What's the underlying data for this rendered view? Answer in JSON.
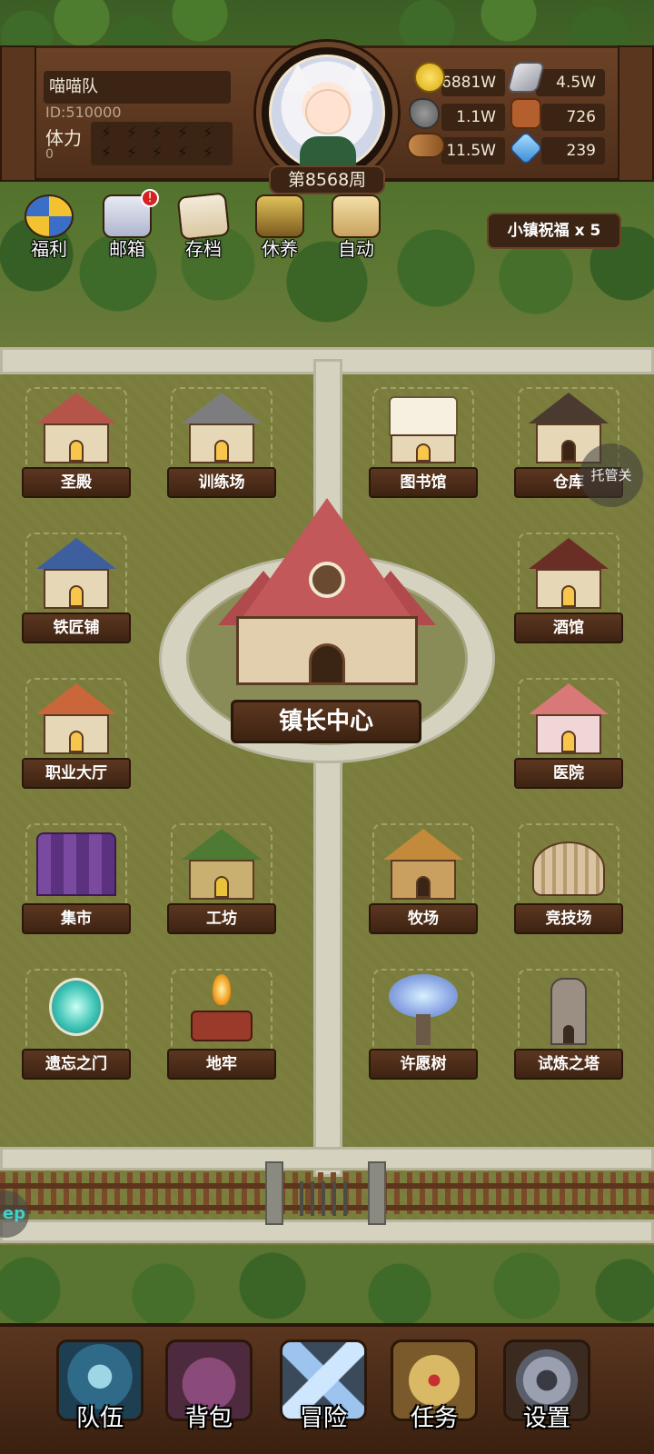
{
  "header": {
    "team_name": "喵喵队",
    "team_id": "ID:510000",
    "stamina_label": "体力",
    "stamina_value": "0",
    "week": "第8568周"
  },
  "resources": {
    "gold": "6881W",
    "iron": "4.5W",
    "stone": "1.1W",
    "leather": "726",
    "wood": "11.5W",
    "crystal": "239"
  },
  "quick_menu": {
    "welfare": "福利",
    "mail": "邮箱",
    "mail_badge": "!",
    "save": "存档",
    "rest": "休养",
    "auto": "自动",
    "blessing": "小镇祝福 x 5"
  },
  "buildings": {
    "temple": "圣殿",
    "training": "训练场",
    "library": "图书馆",
    "warehouse": "仓库",
    "smith": "铁匠铺",
    "tavern": "酒馆",
    "town_hall": "镇长中心",
    "job_hall": "职业大厅",
    "hospital": "医院",
    "market": "集市",
    "workshop": "工坊",
    "ranch": "牧场",
    "arena": "竞技场",
    "forgotten_gate": "遗忘之门",
    "dungeon": "地牢",
    "wish_tree": "许愿树",
    "trial_tower": "试炼之塔"
  },
  "overlays": {
    "host": "托管关",
    "left_float": "ep"
  },
  "nav": {
    "team": "队伍",
    "bag": "背包",
    "adventure": "冒险",
    "quest": "任务",
    "settings": "设置"
  }
}
